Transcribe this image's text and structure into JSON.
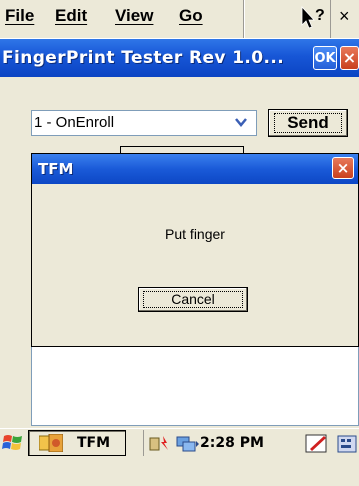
{
  "menubar": {
    "items": [
      "File",
      "Edit",
      "View",
      "Go"
    ],
    "help_icon": "help-pointer-icon",
    "close_label": "×"
  },
  "titlebar": {
    "title": "FingerPrint Tester Rev 1.0...",
    "ok_label": "OK",
    "close_label": "×"
  },
  "main": {
    "command_combo": {
      "selected": "1 - OnEnroll",
      "arrow": "⌄"
    },
    "send_label": "Send"
  },
  "dialog": {
    "title": "TFM",
    "close_label": "×",
    "message": "Put finger",
    "cancel_label": "Cancel"
  },
  "taskbar": {
    "start_icon": "windows-flag-icon",
    "task_label": "TFM",
    "time": "2:28 PM",
    "tray_icons": [
      "battery-icon",
      "network-icon",
      "pen-input-icon",
      "keyboard-icon"
    ]
  },
  "colors": {
    "titlebar": "#1756d6",
    "close_button": "#c9401e",
    "window_bg": "#ece9d8"
  }
}
